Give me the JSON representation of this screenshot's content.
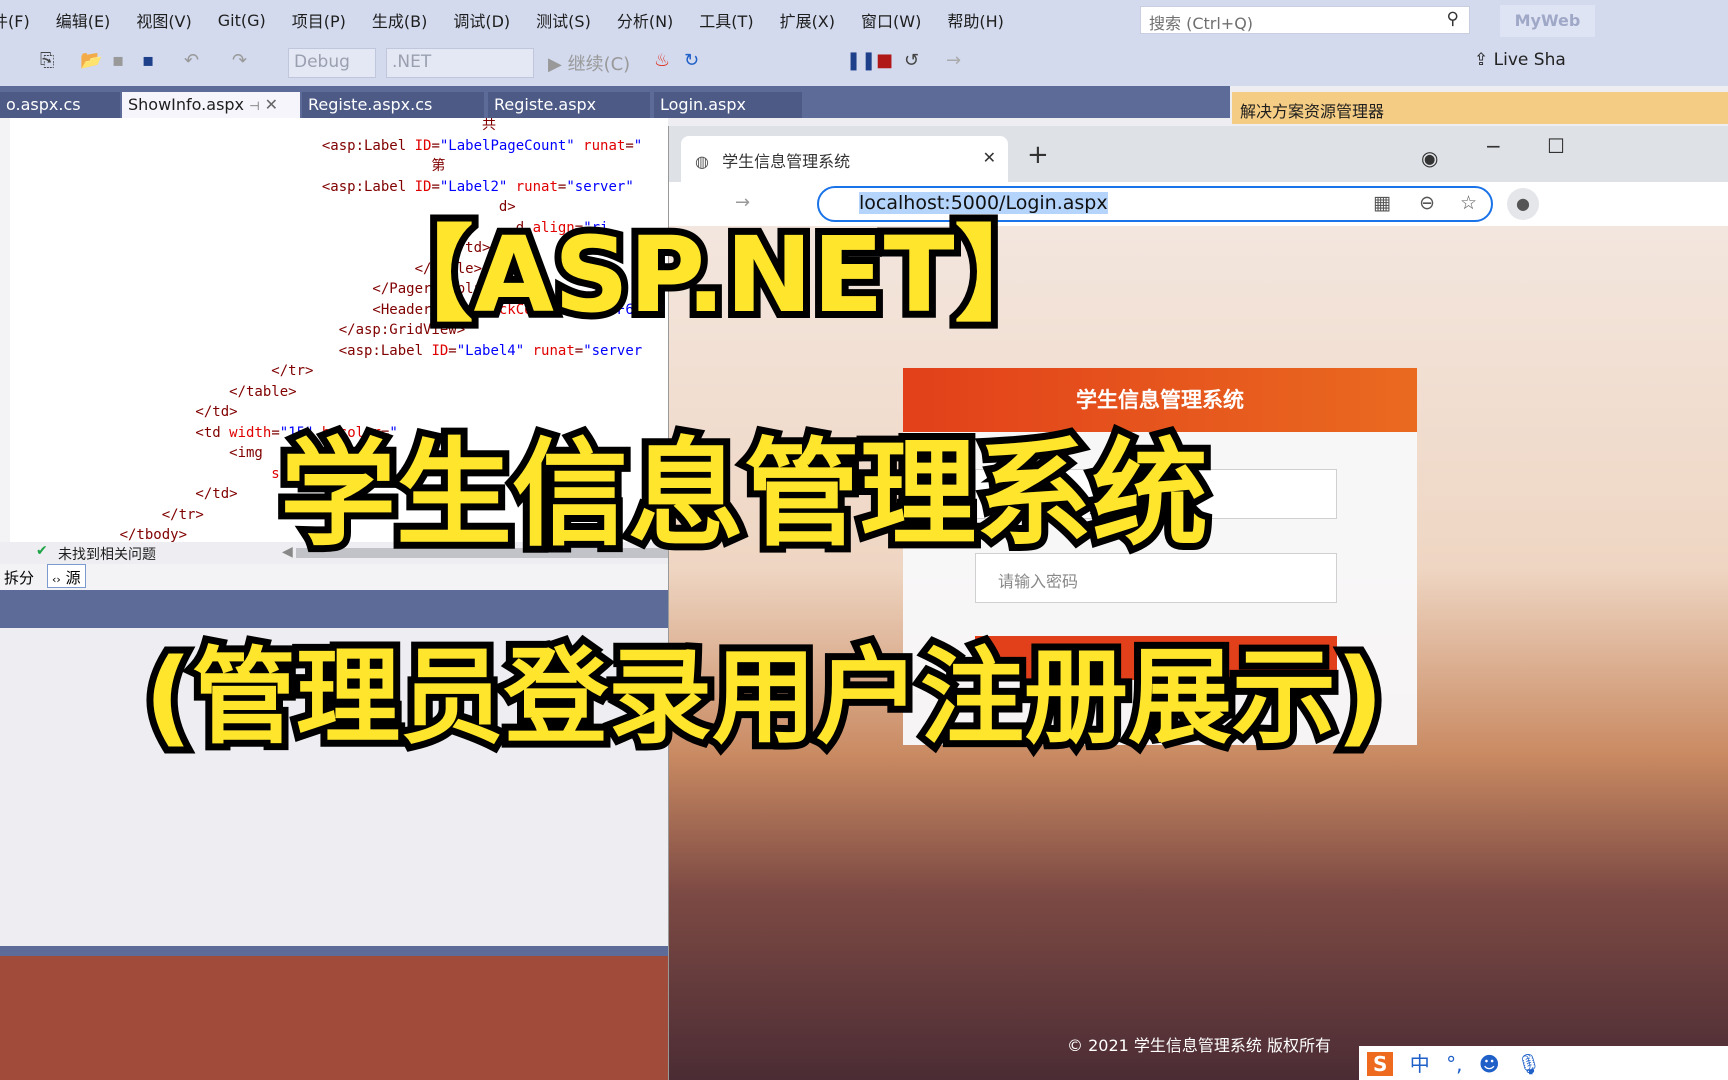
{
  "menu": [
    "件(F)",
    "编辑(E)",
    "视图(V)",
    "Git(G)",
    "项目(P)",
    "生成(B)",
    "调试(D)",
    "测试(S)",
    "分析(N)",
    "工具(T)",
    "扩展(X)",
    "窗口(W)",
    "帮助(H)"
  ],
  "search": {
    "placeholder": "搜索 (Ctrl+Q)"
  },
  "solution_name": "MyWeb",
  "toolbar": {
    "config": "Debug",
    "platform": ".NET",
    "continue": "继续(C)",
    "live_share": "Live Sha"
  },
  "tabs": [
    {
      "label": "o.aspx.cs"
    },
    {
      "label": "ShowInfo.aspx",
      "active": true
    },
    {
      "label": "Registe.aspx.cs"
    },
    {
      "label": "Registe.aspx"
    },
    {
      "label": "Login.aspx"
    }
  ],
  "solution_explorer": "解决方案资源管理器",
  "code_lines": [
    "                                                        共",
    "                                     <asp:Label ID=\"LabelPageCount\" runat=\"",
    "                                                  第",
    "                                     <asp:Label ID=\"Label2\" runat=\"server\"",
    "                                                          d>",
    "                                                            d align=\"ri",
    "                                                    </td>",
    "                                                </table>",
    "                                           </PagerTemplate>",
    "                                           <HeaderStyle BackColor=\"#F6F6F6\"",
    "                                       </asp:GridView>",
    "                                       <asp:Label ID=\"Label4\" runat=\"server",
    "                               </tr>",
    "                          </table>",
    "                      </td>",
    "                      <td width=\"15\" bgcolor=\"",
    "                          <img",
    "                               src=\"Images/bg.jpg\" ",
    "                      </td>",
    "                  </tr>",
    "             </tbody>"
  ],
  "status": {
    "issues": "未找到相关问题",
    "split": "拆分",
    "source": "源"
  },
  "browser": {
    "tab_title": "学生信息管理系统",
    "url_hidden": "localhost:5000/",
    "url_visible": "Login.aspx"
  },
  "login": {
    "header": "学生信息管理系统",
    "username_placeholder": "",
    "password_placeholder": "请输入密码"
  },
  "footer": "© 2021 学生信息管理系统 版权所有",
  "ime": {
    "logo": "S",
    "mode": "中",
    "punct": "°,"
  },
  "overlay": {
    "line1": "【ASP.NET】",
    "line2": "学生信息管理系统",
    "line3": "(管理员登录用户注册展示)"
  },
  "colors": {
    "overlay_fill": "#ffe62c",
    "overlay_stroke": "#000000",
    "vs_tab_bar": "#5d6b99",
    "login_header": "#e2401a"
  }
}
